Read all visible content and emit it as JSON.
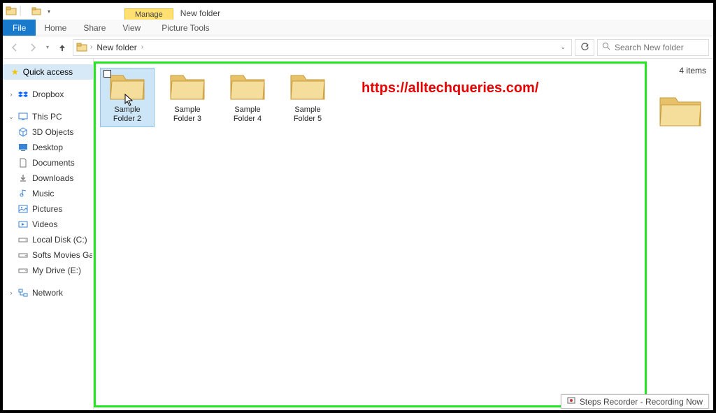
{
  "window_title": "New folder",
  "ribbon": {
    "file": "File",
    "home": "Home",
    "share": "Share",
    "view": "View",
    "manage_header": "Manage",
    "picture_tools": "Picture Tools"
  },
  "breadcrumb": {
    "segments": [
      "New folder"
    ],
    "search_placeholder": "Search New folder"
  },
  "sidebar": {
    "quick_access": "Quick access",
    "dropbox": "Dropbox",
    "this_pc": "This PC",
    "children": [
      "3D Objects",
      "Desktop",
      "Documents",
      "Downloads",
      "Music",
      "Pictures",
      "Videos",
      "Local Disk (C:)",
      "Softs Movies Games",
      "My Drive (E:)"
    ],
    "network": "Network"
  },
  "folders": [
    {
      "name": "Sample Folder 2",
      "selected": true
    },
    {
      "name": "Sample Folder 3",
      "selected": false
    },
    {
      "name": "Sample Folder 4",
      "selected": false
    },
    {
      "name": "Sample Folder 5",
      "selected": false
    }
  ],
  "details": {
    "count_label": "4 items"
  },
  "watermark": "https://alltechqueries.com/",
  "status": {
    "recorder": "Steps Recorder - Recording Now"
  }
}
